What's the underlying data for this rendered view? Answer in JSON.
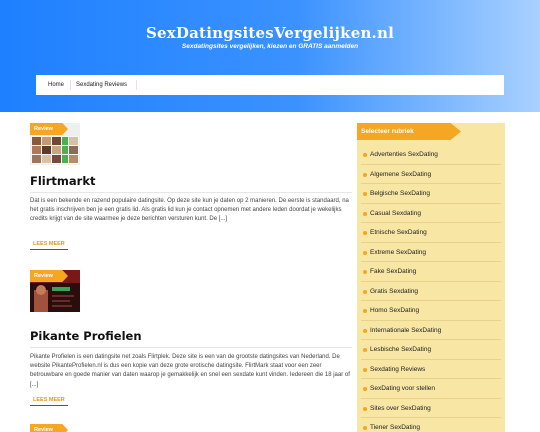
{
  "site": {
    "title": "SexDatingsitesVergelijken.nl",
    "tagline": "Sexdatingsites vergelijken, kiezen en GRATIS aanmelden"
  },
  "nav": {
    "items": [
      "Home",
      "Sexdating Reviews"
    ]
  },
  "posts": [
    {
      "badge": "Review",
      "title": "Flirtmarkt",
      "excerpt": "Dat is een bekende en razend populaire datingsite. Op deze site kun je daten op 2 manieren. De eerste is standaard, na het gratis inschrijven ben je een gratis lid. Als gratis lid kun je contact opnemen met andere leden doordat je wekelijks credits krijgt van de site waarmee je deze berichten versturen kunt. De [...]",
      "read_more": "LEES MEER"
    },
    {
      "badge": "Review",
      "title": "Pikante Profielen",
      "excerpt": "Pikante Profielen is een datingsite net zoals Flirtplek. Deze site is een van de grootste datingsites van Nederland. De website PikanteProfielen.nl is dus een kopie van deze grote erotische datingsite. FlirtMark staat voor een zeer betrouwbare en goede manier van daten waarop je gemakkelijk en snel een sexdate kunt vinden. Iedereen die 18 jaar of [...]",
      "read_more": "LEES MEER"
    },
    {
      "badge": "Review"
    }
  ],
  "sidebar": {
    "heading": "Selecteer rubriek",
    "categories": [
      "Advertenties SexDating",
      "Algemene SexDating",
      "Belgische SexDating",
      "Casual Sexdating",
      "Etnische SexDating",
      "Extreme SexDating",
      "Fake SexDating",
      "Gratis Sexdating",
      "Homo SexDating",
      "Internationale SexDating",
      "Lesbische SexDating",
      "Sexdating Reviews",
      "SexDating voor stellen",
      "Sites over SexDating",
      "Tiener SexDating"
    ]
  },
  "colors": {
    "accent": "#f5a623",
    "header_start": "#1e80ff",
    "header_end": "#a9d1ff",
    "sidebar_bg": "#f8e6a4"
  }
}
